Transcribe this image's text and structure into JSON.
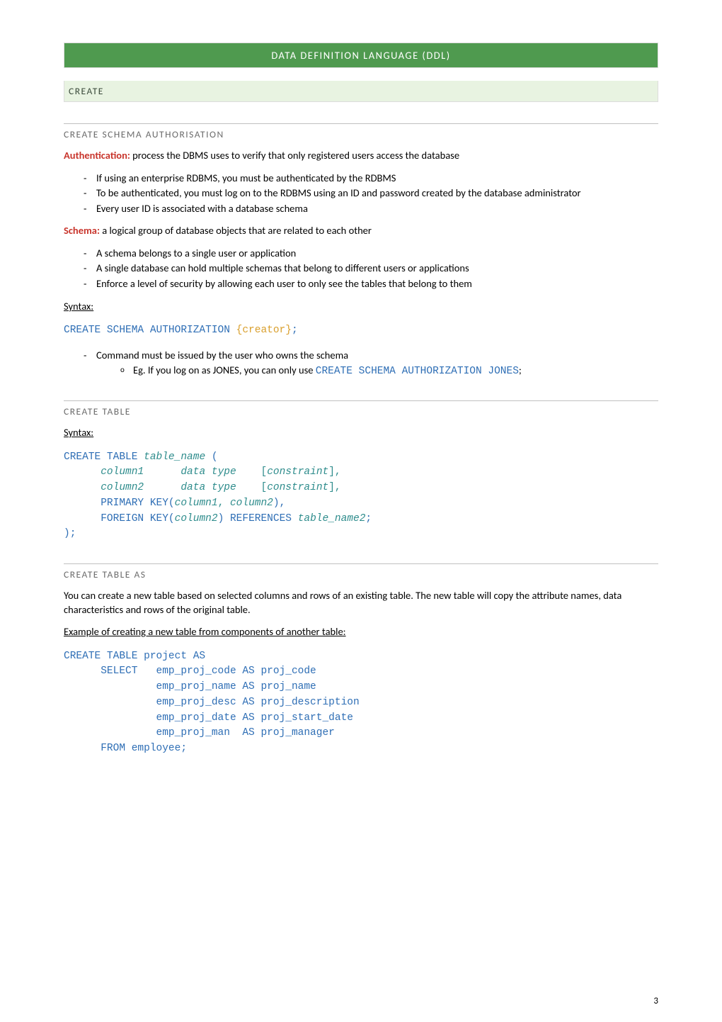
{
  "banner": {
    "title": "DATA DEFINITION LANGUAGE (DDL)"
  },
  "sections": {
    "create": {
      "title": "CREATE",
      "schema_auth": {
        "title": "CREATE SCHEMA AUTHORISATION",
        "auth_label": "Authentication:",
        "auth_text": " process the DBMS uses to verify that only registered users access the database",
        "auth_bullets": [
          "If using an enterprise RDBMS, you must be authenticated by the RDBMS",
          "To be authenticated, you must log on to the RDBMS using an ID and password created by the database administrator",
          "Every user ID is associated with a database schema"
        ],
        "schema_label": "Schema:",
        "schema_text": " a logical group of database objects that are related to each other",
        "schema_bullets": [
          "A schema belongs to a single user or application",
          "A single database can hold multiple schemas that belong to different users or applications",
          "Enforce a level of security by allowing each user to only see the tables that belong to them"
        ],
        "syntax_label": "Syntax:",
        "code_line": "CREATE SCHEMA AUTHORIZATION ",
        "code_param": "{creator}",
        "code_semicolon": ";",
        "issued_text": "Command must be issued by the user who owns the schema",
        "eg_prefix": "Eg. If you log on as JONES, you can only use ",
        "eg_code": "CREATE SCHEMA AUTHORIZATION JONES",
        "eg_semicolon": ";"
      },
      "create_table": {
        "title": "CREATE TABLE",
        "syntax_label": "Syntax:",
        "code": {
          "l1a": "CREATE TABLE ",
          "l1b": "table_name",
          "l1c": " (",
          "l2a": "      ",
          "l2b": "column1",
          "l2gap": "      ",
          "l2c": "data type",
          "l2gap2": "    ",
          "l2d": "[",
          "l2e": "constraint",
          "l2f": "],",
          "l3b": "column2",
          "l3e": "constraint",
          "l4a": "      PRIMARY KEY(",
          "l4b": "column1",
          "l4c": ", ",
          "l4d": "column2",
          "l4e": "),",
          "l5a": "      FOREIGN KEY(",
          "l5b": "column2",
          "l5c": ") REFERENCES ",
          "l5d": "table_name2",
          "l5e": ";",
          "l6": ");"
        }
      },
      "create_table_as": {
        "title": "CREATE TABLE AS",
        "para": "You can create a new table based on selected columns and rows of an existing table. The new table will copy the attribute names, data characteristics and rows of the original table.",
        "example_label": "Example of creating a new table from components of another table:",
        "code": {
          "l1": "CREATE TABLE project AS",
          "l2": "      SELECT   emp_proj_code AS proj_code",
          "l3": "               emp_proj_name AS proj_name",
          "l4": "               emp_proj_desc AS proj_description",
          "l5": "               emp_proj_date AS proj_start_date",
          "l6": "               emp_proj_man  AS proj_manager",
          "l7": "      FROM employee;"
        }
      }
    }
  },
  "page_number": "3"
}
